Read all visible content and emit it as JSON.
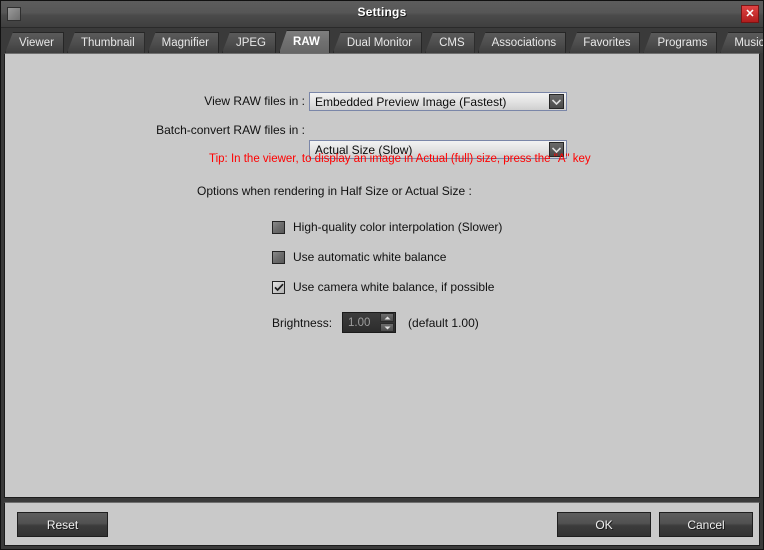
{
  "window": {
    "title": "Settings",
    "icon": "app-icon",
    "close_label": "✕"
  },
  "tabs": [
    {
      "label": "Viewer",
      "active": false
    },
    {
      "label": "Thumbnail",
      "active": false
    },
    {
      "label": "Magnifier",
      "active": false
    },
    {
      "label": "JPEG",
      "active": false
    },
    {
      "label": "RAW",
      "active": true
    },
    {
      "label": "Dual Monitor",
      "active": false
    },
    {
      "label": "CMS",
      "active": false
    },
    {
      "label": "Associations",
      "active": false
    },
    {
      "label": "Favorites",
      "active": false
    },
    {
      "label": "Programs",
      "active": false
    },
    {
      "label": "Music",
      "active": false
    }
  ],
  "main": {
    "view_raw": {
      "label": "View RAW files in :",
      "value": "Embedded Preview Image (Fastest)"
    },
    "batch_convert": {
      "label": "Batch-convert RAW files in :",
      "value": "Actual Size (Slow)"
    },
    "tip": "Tip: In the viewer, to display an image in Actual (full) size, press the \"A\" key",
    "options_note": "Options when rendering in Half Size or Actual Size :",
    "checkboxes": [
      {
        "label": "High-quality color interpolation (Slower)",
        "checked": false
      },
      {
        "label": "Use automatic white balance",
        "checked": false
      },
      {
        "label": "Use camera white balance, if possible",
        "checked": true
      }
    ],
    "brightness": {
      "label": "Brightness:",
      "value": "1.00",
      "default_note": "(default 1.00)"
    }
  },
  "footer": {
    "reset_label": "Reset",
    "ok_label": "OK",
    "cancel_label": "Cancel"
  },
  "colors": {
    "panel": "#c9c9c9",
    "tip_red": "#ff0000",
    "close_red": "#c02020"
  }
}
